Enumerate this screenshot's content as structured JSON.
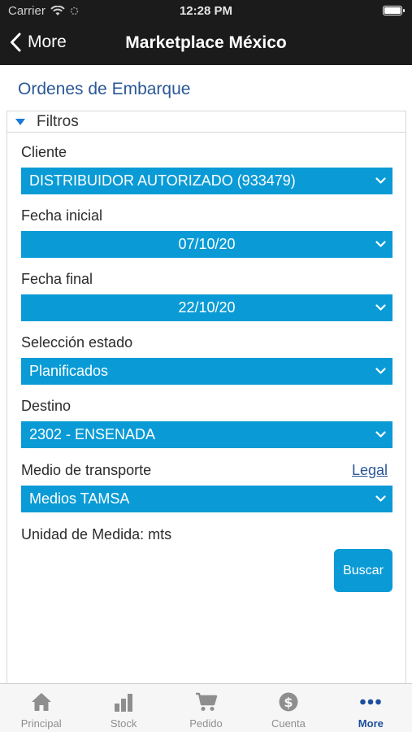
{
  "status_bar": {
    "carrier": "Carrier",
    "time": "12:28 PM"
  },
  "nav": {
    "back_label": "More",
    "title": "Marketplace México"
  },
  "page": {
    "heading": "Ordenes de Embarque"
  },
  "filters": {
    "header": "Filtros",
    "cliente": {
      "label": "Cliente",
      "value": "DISTRIBUIDOR AUTORIZADO (933479)"
    },
    "fecha_inicial": {
      "label": "Fecha inicial",
      "value": "07/10/20"
    },
    "fecha_final": {
      "label": "Fecha final",
      "value": "22/10/20"
    },
    "estado": {
      "label": "Selección estado",
      "value": "Planificados"
    },
    "destino": {
      "label": "Destino",
      "value": "2302 - ENSENADA"
    },
    "transporte": {
      "label": "Medio de transporte",
      "value": "Medios TAMSA",
      "legal_link": "Legal"
    },
    "unidad": "Unidad de Medida: mts",
    "buscar_label": "Buscar"
  },
  "tabs": [
    {
      "label": "Principal",
      "icon": "home-icon"
    },
    {
      "label": "Stock",
      "icon": "bar-chart-icon"
    },
    {
      "label": "Pedido",
      "icon": "cart-icon"
    },
    {
      "label": "Cuenta",
      "icon": "dollar-icon"
    },
    {
      "label": "More",
      "icon": "more-icon",
      "active": true
    }
  ],
  "colors": {
    "accent": "#0a9bd6",
    "nav_bg": "#1b1b1b",
    "heading": "#2a5796",
    "active_tab": "#1d4f9c"
  }
}
